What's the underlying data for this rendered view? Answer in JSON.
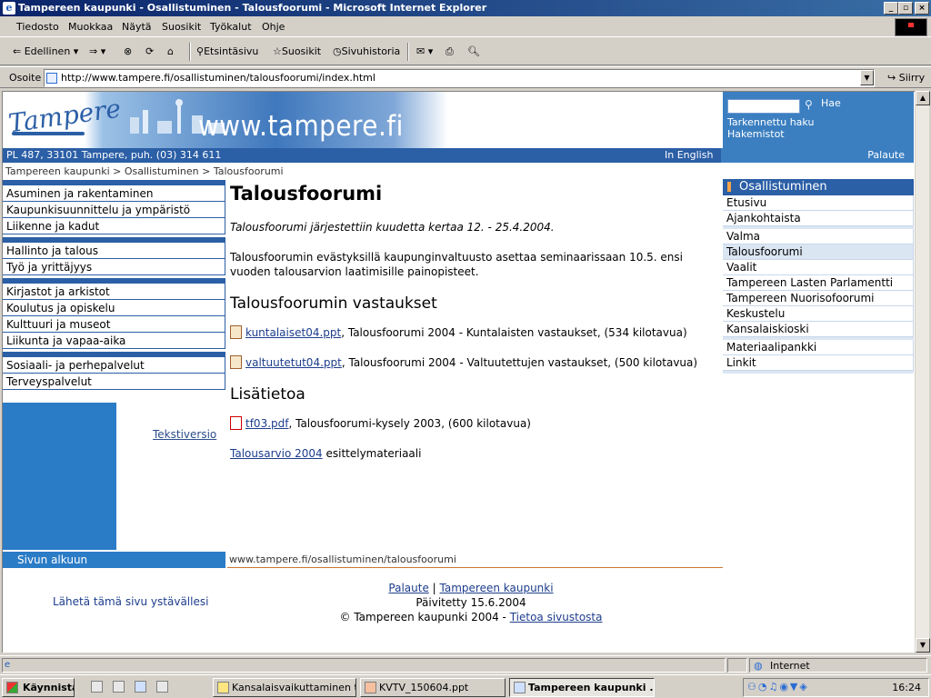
{
  "window": {
    "title": "Tampereen kaupunki - Osallistuminen - Talousfoorumi - Microsoft Internet Explorer"
  },
  "menu": [
    "Tiedosto",
    "Muokkaa",
    "Näytä",
    "Suosikit",
    "Työkalut",
    "Ohje"
  ],
  "toolbar": {
    "back": "Edellinen",
    "search": "Etsintäsivu",
    "favorites": "Suosikit",
    "history": "Sivuhistoria"
  },
  "address": {
    "label": "Osoite",
    "url": "http://www.tampere.fi/osallistuminen/talousfoorumi/index.html",
    "go": "Siirry"
  },
  "page": {
    "site_url": "www.tampere.fi",
    "contact": "PL 487, 33101 Tampere, puh. (03) 314 611",
    "in_english": "In English",
    "search_label": "Hae",
    "advanced_search": "Tarkennettu haku",
    "directories": "Hakemistot",
    "feedback_top": "Palaute",
    "breadcrumb": "Tampereen kaupunki > Osallistuminen > Talousfoorumi",
    "leftnav": [
      [
        "Asuminen ja rakentaminen",
        "Kaupunkisuunnittelu ja ympäristö",
        "Liikenne ja kadut"
      ],
      [
        "Hallinto ja talous",
        "Työ ja yrittäjyys"
      ],
      [
        "Kirjastot ja arkistot",
        "Koulutus ja opiskelu",
        "Kulttuuri ja museot",
        "Liikunta ja vapaa-aika"
      ],
      [
        "Sosiaali- ja perhepalvelut",
        "Terveyspalvelut"
      ]
    ],
    "text_version": "Tekstiversio",
    "to_top": "Sivun alkuun",
    "heading": "Talousfoorumi",
    "intro": "Talousfoorumi järjestettiin kuudetta kertaa 12. - 25.4.2004.",
    "para": "Talousfoorumin evästyksillä kaupunginvaltuusto asettaa seminaarissaan 10.5. ensi vuoden talousarvion laatimisille painopisteet.",
    "answers_heading": "Talousfoorumin vastaukset",
    "file1_link": "kuntalaiset04.ppt",
    "file1_desc": ", Talousfoorumi 2004 - Kuntalaisten vastaukset, (534 kilotavua)",
    "file2_link": "valtuutetut04.ppt",
    "file2_desc": ", Talousfoorumi 2004 - Valtuutettujen vastaukset, (500 kilotavua)",
    "more_heading": "Lisätietoa",
    "file3_link": "tf03.pdf",
    "file3_desc": ", Talousfoorumi-kysely 2003, (600 kilotavua)",
    "budget_link": "Talousarvio 2004",
    "budget_desc": " esittelymateriaali",
    "path": "www.tampere.fi/osallistuminen/talousfoorumi",
    "footer_feedback": "Palaute",
    "footer_sep": " | ",
    "footer_city": "Tampereen kaupunki",
    "updated": "Päivitetty 15.6.2004",
    "copyright": "© Tampereen kaupunki 2004 - ",
    "about_site": "Tietoa sivustosta",
    "send_friend": "Lähetä tämä sivu ystävällesi",
    "rightnav_title": "Osallistuminen",
    "rightnav": [
      [
        "Etusivu",
        "Ajankohtaista"
      ],
      [
        "Valma",
        "Talousfoorumi",
        "Vaalit",
        "Tampereen Lasten Parlamentti",
        "Tampereen Nuorisofoorumi",
        "Keskustelu",
        "Kansalaiskioski"
      ],
      [
        "Materiaalipankki",
        "Linkit"
      ]
    ],
    "rightnav_selected": "Talousfoorumi"
  },
  "status": {
    "zone": "Internet"
  },
  "taskbar": {
    "start": "Käynnistä",
    "tasks": [
      "Kansalaisvaikuttaminen ti...",
      "KVTV_150604.ppt",
      "Tampereen kaupunki ..."
    ],
    "clock": "16:24"
  }
}
